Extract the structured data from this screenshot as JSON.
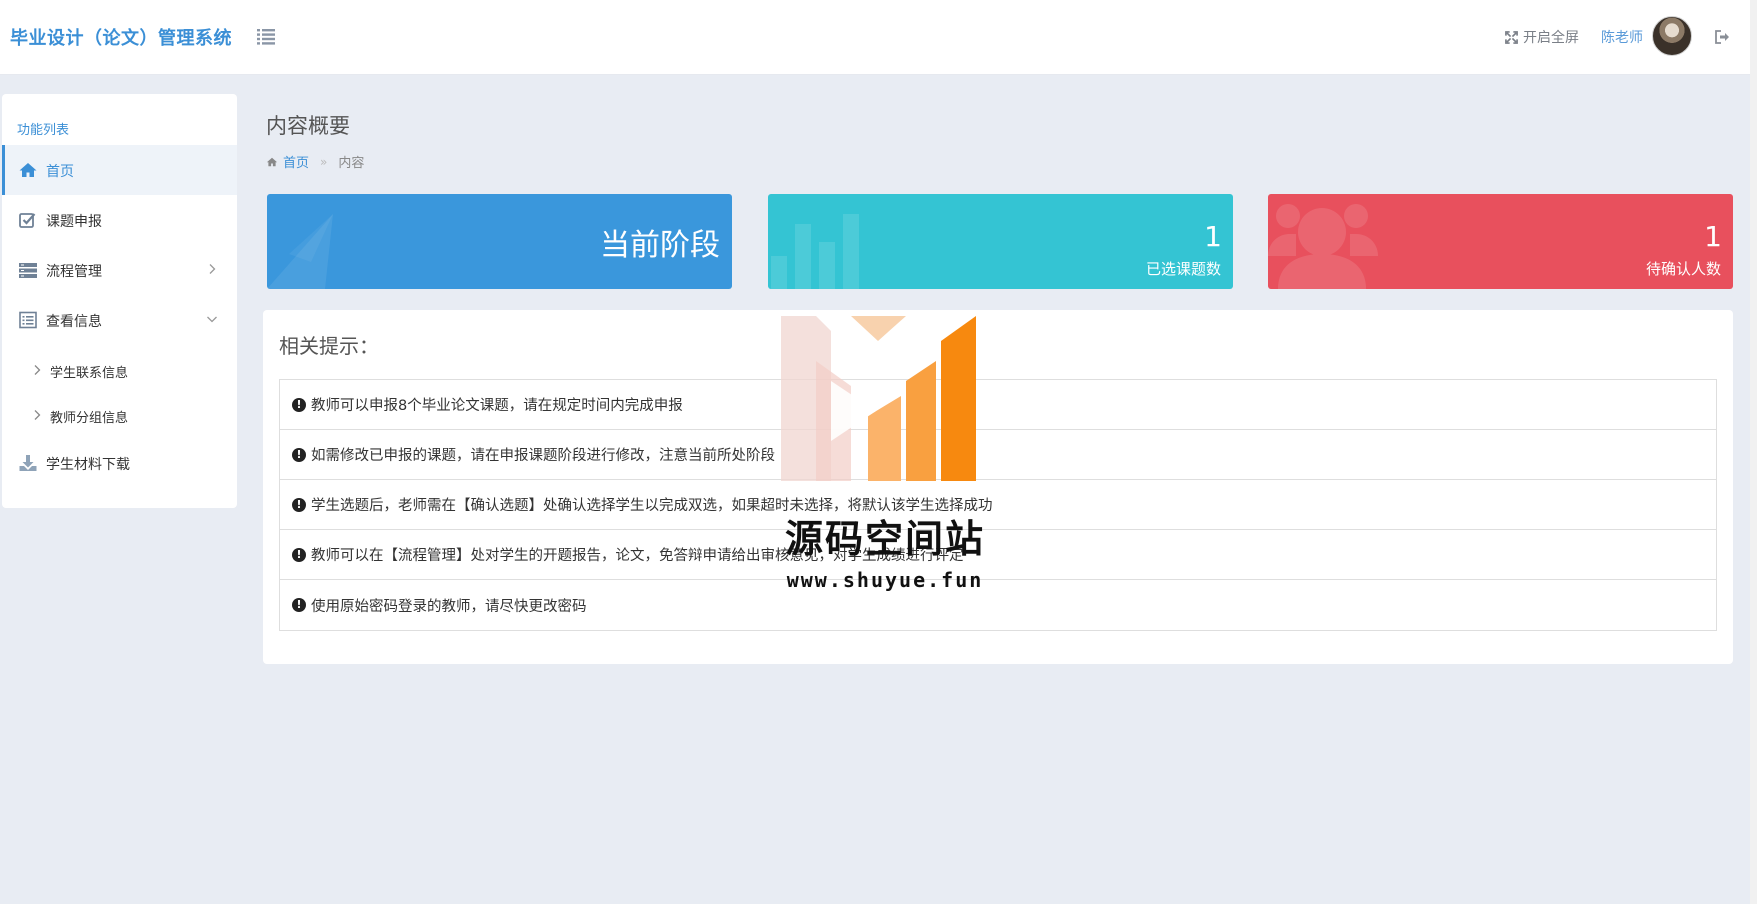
{
  "header": {
    "brand": "毕业设计（论文）管理系统",
    "fullscreen_label": "开启全屏",
    "username": "陈老师"
  },
  "sidebar": {
    "title": "功能列表",
    "items": [
      {
        "label": "首页",
        "icon": "home-icon"
      },
      {
        "label": "课题申报",
        "icon": "check-square-icon"
      },
      {
        "label": "流程管理",
        "icon": "server-icon"
      },
      {
        "label": "查看信息",
        "icon": "list-alt-icon"
      },
      {
        "label": "学生联系信息",
        "icon": "chevron-right-icon"
      },
      {
        "label": "教师分组信息",
        "icon": "chevron-right-icon"
      },
      {
        "label": "学生材料下载",
        "icon": "download-icon"
      }
    ]
  },
  "main": {
    "page_title": "内容概要",
    "breadcrumb": {
      "home": "首页",
      "current": "内容"
    },
    "cards": [
      {
        "text": "当前阶段",
        "color": "#3a97dc"
      },
      {
        "value": "1",
        "label": "已选课题数",
        "color": "#34c4d3"
      },
      {
        "value": "1",
        "label": "待确认人数",
        "color": "#e8505d"
      }
    ],
    "tips_title": "相关提示：",
    "tips": [
      "教师可以申报8个毕业论文课题，请在规定时间内完成申报",
      "如需修改已申报的课题，请在申报课题阶段进行修改，注意当前所处阶段",
      "学生选题后，老师需在【确认选题】处确认选择学生以完成双选，如果超时未选择，将默认该学生选择成功",
      "教师可以在【流程管理】处对学生的开题报告，论文，免答辩申请给出审核意见，对学生成绩进行评定",
      "使用原始密码登录的教师，请尽快更改密码"
    ]
  },
  "watermark": {
    "title": "源码空间站",
    "url": "www.shuyue.fun"
  },
  "colors": {
    "accent": "#3b8fd6",
    "blue_card": "#3a97dc",
    "teal_card": "#34c4d3",
    "red_card": "#e8505d"
  }
}
